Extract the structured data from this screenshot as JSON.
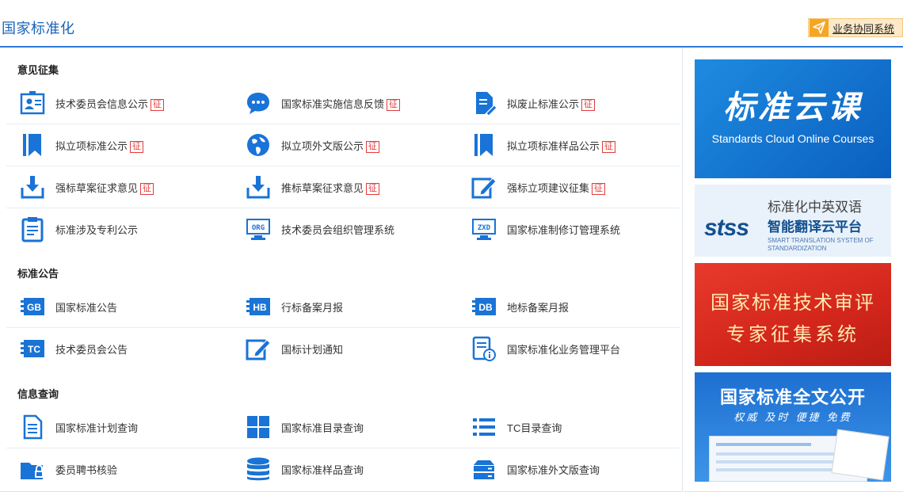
{
  "header": {
    "title": "国家标准化",
    "collab_label": "业务协同系统"
  },
  "badge": "征",
  "sections": [
    {
      "title": "意见征集",
      "rows": [
        [
          {
            "label": "技术委员会信息公示",
            "badge": true,
            "icon": "committee-board-icon"
          },
          {
            "label": "国家标准实施信息反馈",
            "badge": true,
            "icon": "chat-bubble-icon"
          },
          {
            "label": "拟废止标准公示",
            "badge": true,
            "icon": "document-edit-icon"
          }
        ],
        [
          {
            "label": "拟立项标准公示",
            "badge": true,
            "icon": "bookmark-icon"
          },
          {
            "label": "拟立项外文版公示",
            "badge": true,
            "icon": "globe-icon"
          },
          {
            "label": "拟立项标准样品公示",
            "badge": true,
            "icon": "bookmark-icon"
          }
        ],
        [
          {
            "label": "强标草案征求意见",
            "badge": true,
            "icon": "download-tray-icon"
          },
          {
            "label": "推标草案征求意见",
            "badge": true,
            "icon": "download-tray-icon"
          },
          {
            "label": "强标立项建议征集",
            "badge": true,
            "icon": "pencil-square-icon"
          }
        ],
        [
          {
            "label": "标准涉及专利公示",
            "badge": false,
            "icon": "patent-clipboard-icon"
          },
          {
            "label": "技术委员会组织管理系统",
            "badge": false,
            "icon": "org-monitor-icon",
            "tag": "ORG"
          },
          {
            "label": "国家标准制修订管理系统",
            "badge": false,
            "icon": "zxd-monitor-icon",
            "tag": "ZXD"
          }
        ]
      ]
    },
    {
      "title": "标准公告",
      "rows": [
        [
          {
            "label": "国家标准公告",
            "badge": false,
            "icon": "gb-tag-icon",
            "tag": "GB"
          },
          {
            "label": "行标备案月报",
            "badge": false,
            "icon": "hb-tag-icon",
            "tag": "HB"
          },
          {
            "label": "地标备案月报",
            "badge": false,
            "icon": "db-tag-icon",
            "tag": "DB"
          }
        ],
        [
          {
            "label": "技术委员会公告",
            "badge": false,
            "icon": "tc-tag-icon",
            "tag": "TC"
          },
          {
            "label": "国标计划通知",
            "badge": false,
            "icon": "pencil-square-icon"
          },
          {
            "label": "国家标准化业务管理平台",
            "badge": false,
            "icon": "document-info-icon"
          }
        ]
      ]
    },
    {
      "title": "信息查询",
      "rows": [
        [
          {
            "label": "国家标准计划查询",
            "badge": false,
            "icon": "document-lines-icon"
          },
          {
            "label": "国家标准目录查询",
            "badge": false,
            "icon": "grid-icon"
          },
          {
            "label": "TC目录查询",
            "badge": false,
            "icon": "list-icon"
          }
        ],
        [
          {
            "label": "委员聘书核验",
            "badge": false,
            "icon": "folder-lock-icon"
          },
          {
            "label": "国家标准样品查询",
            "badge": false,
            "icon": "database-icon"
          },
          {
            "label": "国家标准外文版查询",
            "badge": false,
            "icon": "server-icon"
          }
        ]
      ]
    }
  ],
  "banners": {
    "cloud": {
      "title": "标准云课",
      "subtitle": "Standards Cloud Online Courses"
    },
    "stss": {
      "logo": "stss",
      "line1": "标准化中英双语",
      "line2": "智能翻译云平台",
      "line3": "SMART TRANSLATION SYSTEM OF STANDARDIZATION"
    },
    "expert": {
      "line1": "国家标准技术审评",
      "line2": "专家征集系统"
    },
    "fulltext": {
      "title": "国家标准全文公开",
      "slogan": "权威 及时 便捷 免费"
    }
  },
  "colors": {
    "accent": "#2e7bd6",
    "icon": "#1a73d6",
    "badge": "#e23b3b"
  }
}
